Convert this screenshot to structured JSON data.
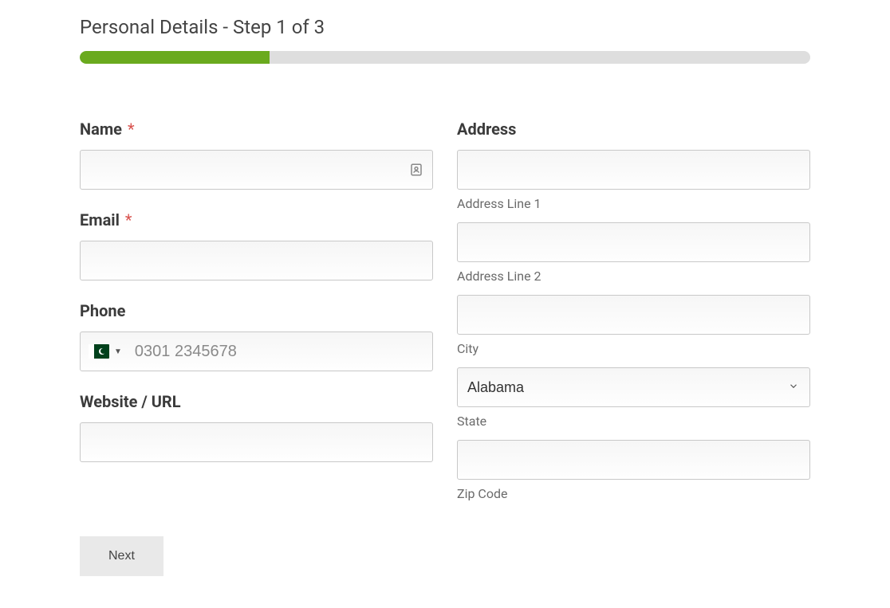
{
  "title": "Personal Details - Step 1 of 3",
  "progress": {
    "percent": 26
  },
  "left": {
    "name": {
      "label": "Name",
      "required": true,
      "value": ""
    },
    "email": {
      "label": "Email",
      "required": true,
      "value": ""
    },
    "phone": {
      "label": "Phone",
      "placeholder": "0301 2345678",
      "value": "",
      "country": "Pakistan"
    },
    "website": {
      "label": "Website / URL",
      "value": ""
    }
  },
  "right": {
    "address": {
      "label": "Address",
      "line1": {
        "value": "",
        "sublabel": "Address Line 1"
      },
      "line2": {
        "value": "",
        "sublabel": "Address Line 2"
      },
      "city": {
        "value": "",
        "sublabel": "City"
      },
      "state": {
        "selected": "Alabama",
        "sublabel": "State"
      },
      "zip": {
        "value": "",
        "sublabel": "Zip Code"
      }
    }
  },
  "actions": {
    "next": "Next"
  },
  "required_star": "*"
}
